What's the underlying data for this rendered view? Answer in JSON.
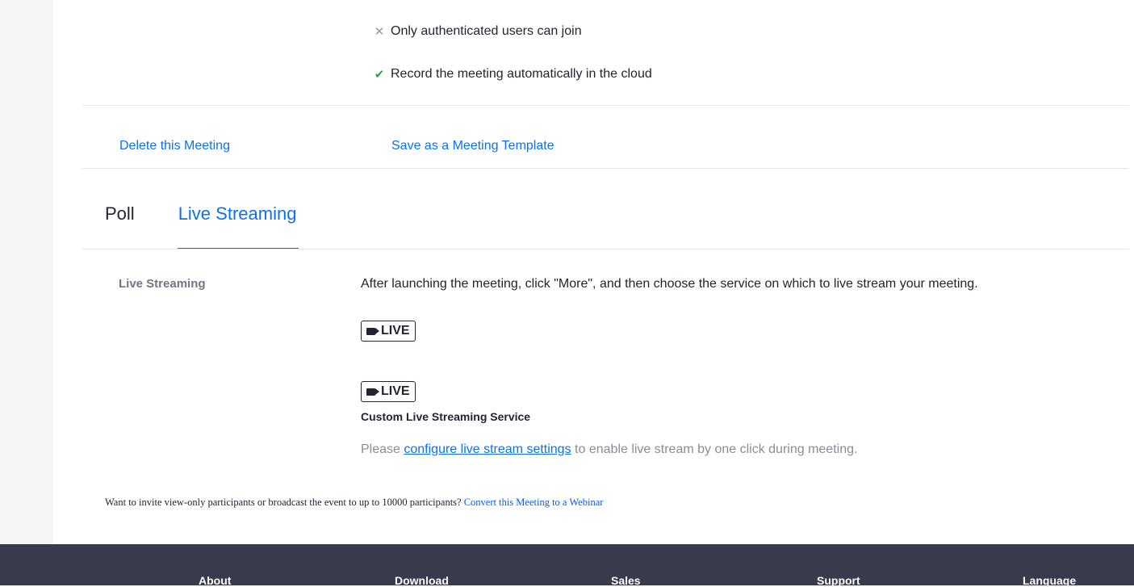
{
  "options": {
    "authenticated": "Only authenticated users can join",
    "record_cloud": "Record the meeting automatically in the cloud"
  },
  "actions": {
    "delete": "Delete this Meeting",
    "save_template": "Save as a Meeting Template"
  },
  "tabs": [
    "Poll",
    "Live Streaming"
  ],
  "live_streaming": {
    "label": "Live Streaming",
    "description": "After launching the meeting, click \"More\", and then choose the service on which to live stream your meeting.",
    "live_badge": "LIVE",
    "custom_title": "Custom Live Streaming Service",
    "note_prefix": "Please",
    "note_link": "configure live stream settings",
    "note_suffix": "to enable live stream by one click during meeting."
  },
  "webinar": {
    "prompt": "Want to invite view-only participants or broadcast the event to up to 10000 participants?",
    "link": "Convert this Meeting to a Webinar"
  },
  "footer": [
    "About",
    "Download",
    "Sales",
    "Support",
    "Language"
  ],
  "colors": {
    "accent": "#0e71eb",
    "footer_bg": "#3a3a4d",
    "check": "#2da44e"
  }
}
